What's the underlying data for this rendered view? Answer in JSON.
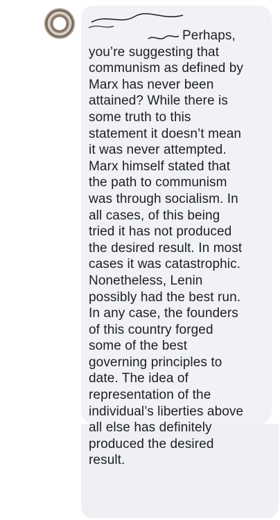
{
  "comment": {
    "lines": [
      "Perhaps,",
      "you’re suggesting that",
      "communism as defined by",
      "Marx has never been",
      "attained? While there is",
      "some truth to this",
      "statement it doesn’t mean",
      "it was never attempted.",
      "Marx himself stated that",
      "the path to communism",
      "was through socialism. In",
      "all cases, of this being",
      "tried it has not produced",
      "the desired result. In most",
      "cases it was catastrophic.",
      "Nonetheless, Lenin",
      "possibly had the best run.",
      "In any case, the founders",
      "of this country forged",
      "some of the best",
      "governing principles to",
      "date. The idea of",
      "representation of the",
      "individual’s liberties above",
      "all else has definitely",
      "produced the desired",
      "result."
    ]
  },
  "colors": {
    "bubble": "#f0f2f5",
    "text": "#1c1e21"
  }
}
